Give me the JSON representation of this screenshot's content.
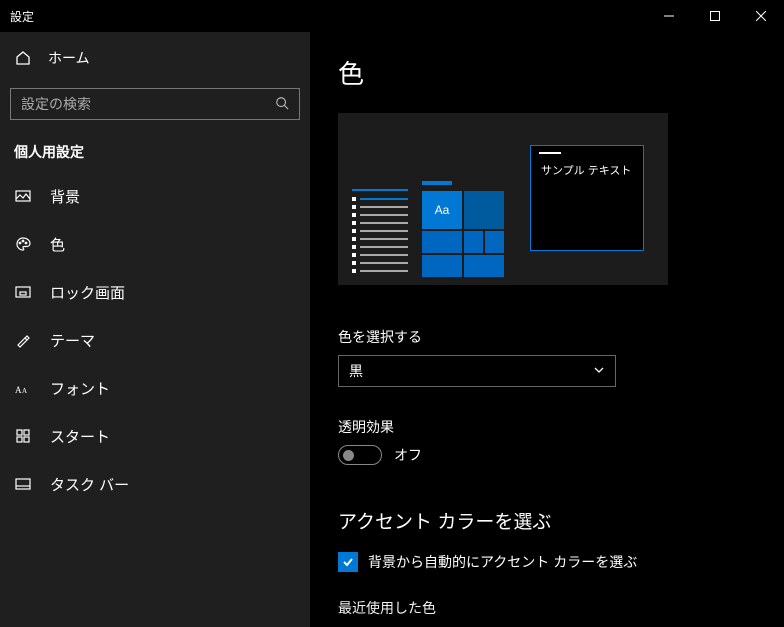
{
  "titlebar": {
    "title": "設定"
  },
  "sidebar": {
    "home": "ホーム",
    "search_placeholder": "設定の検索",
    "category": "個人用設定",
    "items": [
      {
        "label": "背景"
      },
      {
        "label": "色"
      },
      {
        "label": "ロック画面"
      },
      {
        "label": "テーマ"
      },
      {
        "label": "フォント"
      },
      {
        "label": "スタート"
      },
      {
        "label": "タスク バー"
      }
    ]
  },
  "main": {
    "title": "色",
    "preview_sample": "サンプル テキスト",
    "preview_aa": "Aa",
    "choose_color_label": "色を選択する",
    "choose_color_value": "黒",
    "transparency_label": "透明効果",
    "transparency_value": "オフ",
    "accent_heading": "アクセント カラーを選ぶ",
    "auto_accent_label": "背景から自動的にアクセント カラーを選ぶ",
    "recent_label": "最近使用した色"
  }
}
